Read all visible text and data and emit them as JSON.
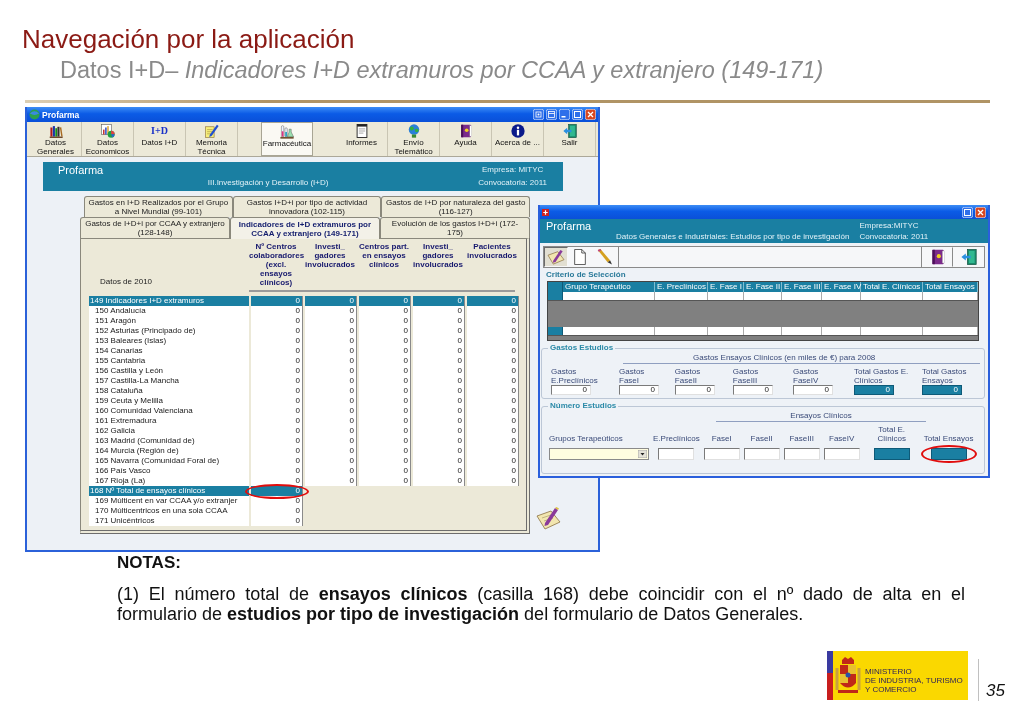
{
  "slide": {
    "title": "Navegación por la aplicación",
    "subtitle": "Datos I+D– *Indicadores I+D extramuros por CCAA y extranjero (149-171)*"
  },
  "main_window": {
    "title": "Profarma",
    "toolbar": [
      {
        "buttons": [
          {
            "label": "Datos Generales",
            "selected": false
          },
          {
            "label": "Datos Economicos",
            "selected": false
          },
          {
            "label": "Datos I+D",
            "icon_text": "I+D",
            "selected": false
          },
          {
            "label": "Memoria Técnica",
            "selected": false
          }
        ]
      },
      {
        "buttons": [
          {
            "label": "Farmacéutica",
            "selected": true
          }
        ]
      },
      {
        "buttons": [
          {
            "label": "Informes",
            "selected": false
          },
          {
            "label": "Envío Telemático",
            "selected": false
          },
          {
            "label": "Ayuda",
            "selected": false
          },
          {
            "label": "Acerca de ...",
            "selected": false
          },
          {
            "label": "Salir",
            "selected": false
          }
        ]
      }
    ],
    "banner": {
      "app_name": "Profarma",
      "section": "III.Investigación y Desarrollo (I+D)",
      "company": "Empresa: MITYC",
      "call": "Convocatoria: 2011"
    },
    "tab_rows": [
      {
        "tabs": [
          {
            "label": "Gastos en I+D Realizados por el Grupo a Nivel Mundial (99-101)",
            "selected": false
          },
          {
            "label": "Gastos I+D+i por tipo de actividad innovadora (102-115)",
            "selected": false
          },
          {
            "label": "Gastos de I+D por naturaleza del gasto (116-127)",
            "selected": false
          }
        ]
      },
      {
        "tabs": [
          {
            "label": "Gastos de I+D+i por CCAA y extranjero (128-148)",
            "selected": false
          },
          {
            "label": "Indicadores de I+D extramuros por CCAA y extranjero (149-171)",
            "selected": true
          },
          {
            "label": "Evolución de los gastos I+D+i (172-175)",
            "selected": false
          }
        ]
      }
    ],
    "table": {
      "corner_label": "Datos de 2010",
      "columns": [
        "Nº Centros colaboradores (excl. ensayos clínicos)",
        "Investi_ gadores involucrados",
        "Centros part. en ensayos clínicos",
        "Investi_ gadores involucrados",
        "Pacientes involucrados"
      ],
      "rows": [
        {
          "label": "149 Indicadores I+D extramuros",
          "kind": "total",
          "values": [
            "0",
            "0",
            "0",
            "0",
            "0"
          ],
          "circled": false
        },
        {
          "label": "150 Andalucía",
          "kind": "item",
          "values": [
            "0",
            "0",
            "0",
            "0",
            "0"
          ],
          "circled": false
        },
        {
          "label": "151 Aragón",
          "kind": "item",
          "values": [
            "0",
            "0",
            "0",
            "0",
            "0"
          ],
          "circled": false
        },
        {
          "label": "152 Asturias (Principado de)",
          "kind": "item",
          "values": [
            "0",
            "0",
            "0",
            "0",
            "0"
          ],
          "circled": false
        },
        {
          "label": "153 Baleares (Islas)",
          "kind": "item",
          "values": [
            "0",
            "0",
            "0",
            "0",
            "0"
          ],
          "circled": false
        },
        {
          "label": "154 Canarias",
          "kind": "item",
          "values": [
            "0",
            "0",
            "0",
            "0",
            "0"
          ],
          "circled": false
        },
        {
          "label": "155 Cantabria",
          "kind": "item",
          "values": [
            "0",
            "0",
            "0",
            "0",
            "0"
          ],
          "circled": false
        },
        {
          "label": "156 Castilla y León",
          "kind": "item",
          "values": [
            "0",
            "0",
            "0",
            "0",
            "0"
          ],
          "circled": false
        },
        {
          "label": "157 Castilla-La Mancha",
          "kind": "item",
          "values": [
            "0",
            "0",
            "0",
            "0",
            "0"
          ],
          "circled": false
        },
        {
          "label": "158 Cataluña",
          "kind": "item",
          "values": [
            "0",
            "0",
            "0",
            "0",
            "0"
          ],
          "circled": false
        },
        {
          "label": "159 Ceuta y Melilla",
          "kind": "item",
          "values": [
            "0",
            "0",
            "0",
            "0",
            "0"
          ],
          "circled": false
        },
        {
          "label": "160 Comunidad Valenciana",
          "kind": "item",
          "values": [
            "0",
            "0",
            "0",
            "0",
            "0"
          ],
          "circled": false
        },
        {
          "label": "161 Extremadura",
          "kind": "item",
          "values": [
            "0",
            "0",
            "0",
            "0",
            "0"
          ],
          "circled": false
        },
        {
          "label": "162 Galicia",
          "kind": "item",
          "values": [
            "0",
            "0",
            "0",
            "0",
            "0"
          ],
          "circled": false
        },
        {
          "label": "163 Madrid (Comunidad de)",
          "kind": "item",
          "values": [
            "0",
            "0",
            "0",
            "0",
            "0"
          ],
          "circled": false
        },
        {
          "label": "164 Murcia (Región de)",
          "kind": "item",
          "values": [
            "0",
            "0",
            "0",
            "0",
            "0"
          ],
          "circled": false
        },
        {
          "label": "165 Navarra (Comunidad Foral de)",
          "kind": "item",
          "values": [
            "0",
            "0",
            "0",
            "0",
            "0"
          ],
          "circled": false
        },
        {
          "label": "166 País Vasco",
          "kind": "item",
          "values": [
            "0",
            "0",
            "0",
            "0",
            "0"
          ],
          "circled": false
        },
        {
          "label": "167 Rioja (La)",
          "kind": "item",
          "values": [
            "0",
            "0",
            "0",
            "0",
            "0"
          ],
          "circled": false
        },
        {
          "label": "168 Nº Total de ensayos clínicos",
          "kind": "total",
          "values": [
            "0"
          ],
          "circled": true
        },
        {
          "label": "169 Múlticent en var CCAA y/o extranjer",
          "kind": "item",
          "values": [
            "0"
          ],
          "circled": false
        },
        {
          "label": "170 Múlticentricos en una sola CCAA",
          "kind": "item",
          "values": [
            "0"
          ],
          "circled": false
        },
        {
          "label": "171 Unicéntricos",
          "kind": "item",
          "values": [
            "0"
          ],
          "circled": false
        }
      ]
    }
  },
  "detail_window": {
    "banner": {
      "app_name": "Profarma",
      "section": "Datos Generales e Industriales: Estudios por tipo de investigación",
      "company": "Empresa:MITYC",
      "call": "Convocatoria: 2011"
    },
    "toolbar": {
      "left": [
        {
          "selected": true
        },
        {
          "selected": false
        },
        {
          "selected": false
        }
      ],
      "right": [
        {
          "selected": false
        },
        {
          "selected": false
        }
      ]
    },
    "criteria": {
      "title": "Criterio de Selección",
      "columns": [
        "Grupo Terapéutico",
        "E. Preclínicos",
        "E. Fase I",
        "E. Fase II",
        "E. Fase III",
        "E. Fase IV",
        "Total E. Clínicos",
        "Total Ensayos"
      ]
    },
    "costs": {
      "legend": "Gastos Estudios",
      "caption": "Gastos Ensayos Clínicos (en miles de €) para 2008",
      "fields": [
        {
          "label": "Gastos E.Preclínicos",
          "kind": "input",
          "value": "0"
        },
        {
          "label": "Gastos FaseI",
          "kind": "input",
          "value": "0"
        },
        {
          "label": "Gastos FaseII",
          "kind": "input",
          "value": "0"
        },
        {
          "label": "Gastos FaseIII",
          "kind": "input",
          "value": "0"
        },
        {
          "label": "Gastos FaseIV",
          "kind": "input",
          "value": "0"
        },
        {
          "label": "Total Gastos E. Clínicos",
          "kind": "total",
          "value": "0"
        },
        {
          "label": "Total Gastos Ensayos",
          "kind": "total",
          "value": "0"
        }
      ]
    },
    "counts": {
      "legend": "Número Estudios",
      "caption": "Ensayos Clínicos",
      "fields": [
        {
          "label": "Grupos Terapeúticos",
          "kind": "select",
          "circled": false
        },
        {
          "label": "E.Preclínicos",
          "kind": "input",
          "circled": false
        },
        {
          "label": "FaseI",
          "kind": "input",
          "circled": false
        },
        {
          "label": "FaseII",
          "kind": "input",
          "circled": false
        },
        {
          "label": "FaseIII",
          "kind": "input",
          "circled": false
        },
        {
          "label": "FaseIV",
          "kind": "input",
          "circled": false
        },
        {
          "label": "Total E. Clínicos",
          "kind": "total",
          "circled": false
        },
        {
          "label": "Total Ensayos",
          "kind": "total",
          "circled": true
        }
      ]
    }
  },
  "notes": {
    "heading": "NOTAS:",
    "text": "(1) El número total de **ensayos clínicos** (casilla 168) debe coincidir con el nº dado de alta en el formulario de **estudios por tipo de investigación** del formulario de Datos Generales."
  },
  "footer": {
    "logo_lines": [
      "MINISTERIO",
      "DE INDUSTRIA, TURISMO",
      "Y COMERCIO"
    ],
    "page_number": "35"
  }
}
